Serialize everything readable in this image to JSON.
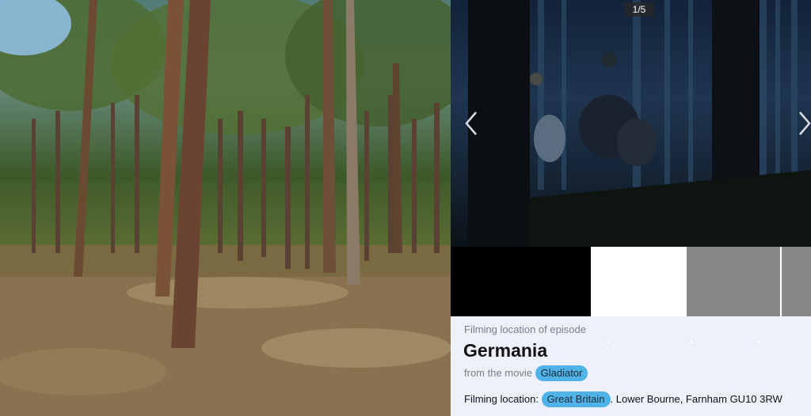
{
  "gallery": {
    "counter": "1/5",
    "prev_icon": "chevron-left-icon",
    "next_icon": "chevron-right-icon",
    "thumbnails": [
      {
        "color": "#000000"
      },
      {
        "color": "#ffffff"
      },
      {
        "color": "#888888"
      },
      {
        "color": "#888888"
      }
    ]
  },
  "info": {
    "episode_label": "Filming location of episode",
    "title": "Germania",
    "movie_prefix": "from the movie",
    "movie_tag": "Gladiator",
    "location_label": "Filming location:",
    "location_tag": "Great Britain",
    "address": ". Lower Bourne, Farnham GU10 3RW"
  },
  "colors": {
    "tag_bg": "#4fb3e8",
    "panel_bg": "#eef0fb",
    "muted_text": "#7a7e8a"
  }
}
